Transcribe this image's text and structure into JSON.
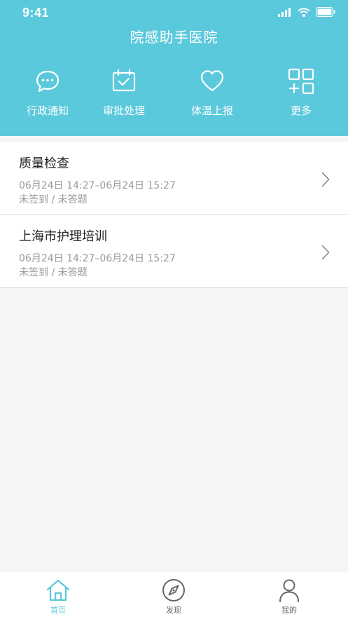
{
  "status_bar": {
    "time": "9:41"
  },
  "header": {
    "title": "院感助手医院"
  },
  "quick_actions": [
    {
      "label": "行政通知",
      "icon": "chat-bubble-icon"
    },
    {
      "label": "审批处理",
      "icon": "calendar-check-icon"
    },
    {
      "label": "体温上报",
      "icon": "heart-icon"
    },
    {
      "label": "更多",
      "icon": "grid-plus-icon"
    }
  ],
  "list": [
    {
      "title": "质量检查",
      "time": "06月24日 14:27–06月24日 15:27",
      "status": "未签到 / 未答题"
    },
    {
      "title": "上海市护理培训",
      "time": "06月24日 14:27–06月24日 15:27",
      "status": "未签到 / 未答题"
    }
  ],
  "tabbar": [
    {
      "label": "首页",
      "icon": "home-icon",
      "active": true
    },
    {
      "label": "发现",
      "icon": "compass-icon",
      "active": false
    },
    {
      "label": "我的",
      "icon": "user-icon",
      "active": false
    }
  ],
  "colors": {
    "accent": "#5bc9dc",
    "background": "#f5f5f5"
  }
}
